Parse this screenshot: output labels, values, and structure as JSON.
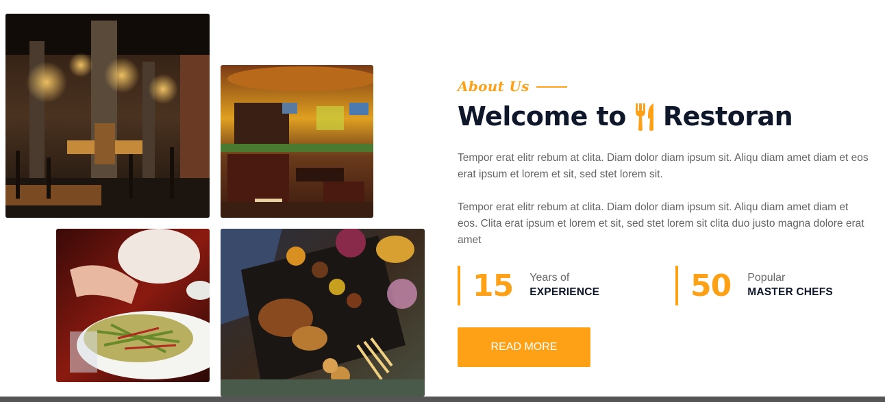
{
  "images": {
    "interior_1": "restaurant-interior-dark",
    "interior_2": "restaurant-interior-yellow",
    "food_1": "salad-plate",
    "food_2": "grilled-platter"
  },
  "about": {
    "label": "About Us"
  },
  "title": {
    "prefix": "Welcome to",
    "brand": "Restoran",
    "icon": "utensils-icon"
  },
  "paragraphs": [
    "Tempor erat elitr rebum at clita. Diam dolor diam ipsum sit. Aliqu diam amet diam et eos erat ipsum et lorem et sit, sed stet lorem sit.",
    "Tempor erat elitr rebum at clita. Diam dolor diam ipsum sit. Aliqu diam amet diam et eos. Clita erat ipsum et lorem et sit, sed stet lorem sit clita duo justo magna dolore erat amet"
  ],
  "stats": [
    {
      "number": "15",
      "top": "Years of",
      "bottom": "EXPERIENCE"
    },
    {
      "number": "50",
      "top": "Popular",
      "bottom": "MASTER CHEFS"
    }
  ],
  "button": {
    "label": "READ MORE"
  },
  "colors": {
    "accent": "#FEA116",
    "dark": "#0F172B",
    "text": "#666565"
  }
}
